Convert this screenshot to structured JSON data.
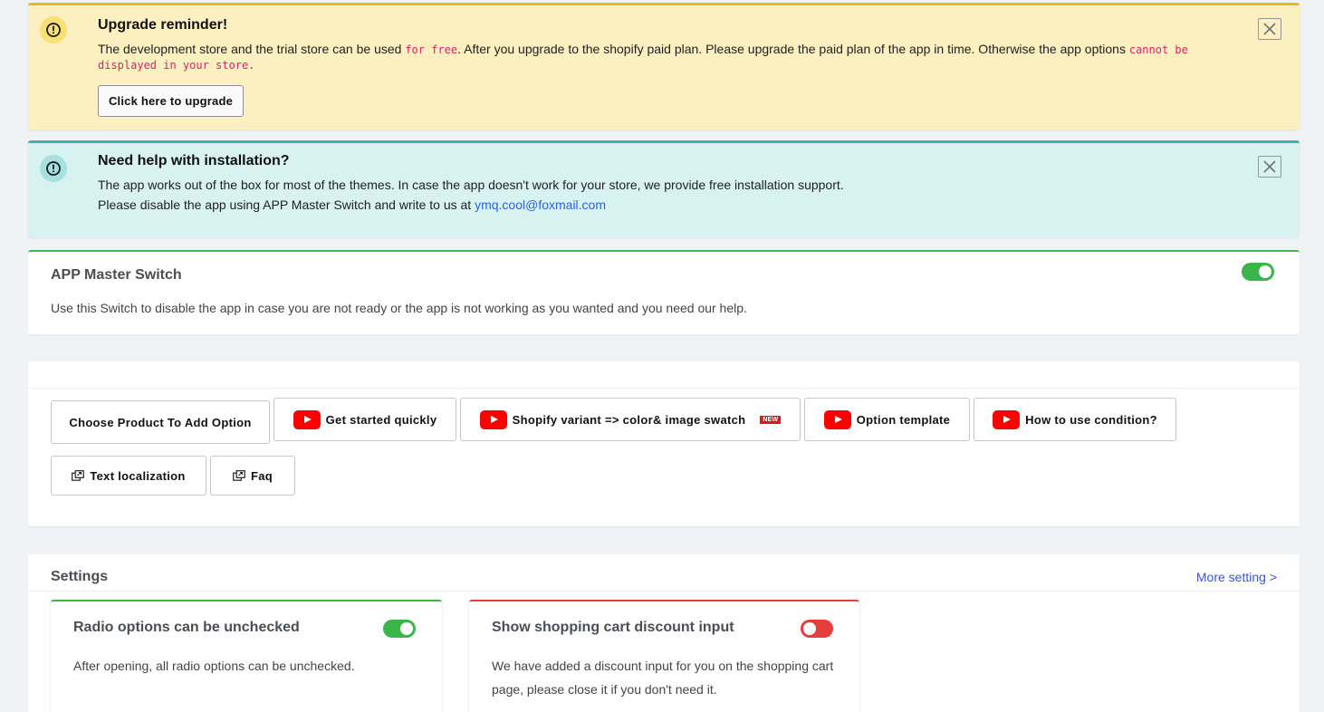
{
  "upgrade": {
    "title": "Upgrade reminder!",
    "text_1": "The development store and the trial store can be used ",
    "code_1": "for free",
    "text_2": ". After you upgrade to the shopify paid plan. Please upgrade the paid plan of the app in time. Otherwise the app options ",
    "code_2": "cannot be",
    "code_3": "displayed in your store.",
    "button_label": "Click here to upgrade",
    "icon": "exclamation-circle-icon"
  },
  "help": {
    "title": "Need help with installation?",
    "line_1": "The app works out of the box for most of the themes. In case the app doesn't work for your store, we provide free installation support.",
    "line_2_prefix": "Please disable the app using APP Master Switch and write to us at ",
    "email": "ymq.cool@foxmail.com",
    "icon": "info-circle-icon"
  },
  "master_switch": {
    "title": "APP Master Switch",
    "description": "Use this Switch to disable the app in case you are not ready or the app is not working as you wanted and you need our help.",
    "enabled": true
  },
  "actions": {
    "choose_product": "Choose Product To Add Option",
    "get_started": "Get started quickly",
    "variant_swatch": "Shopify variant => color& image swatch",
    "new_badge": "NEW",
    "option_template": "Option template",
    "use_condition": "How to use condition?",
    "text_localization": "Text localization",
    "faq": "Faq"
  },
  "settings": {
    "title": "Settings",
    "more_link": "More setting >",
    "radio": {
      "title": "Radio options can be unchecked",
      "description": "After opening, all radio options can be unchecked.",
      "enabled": true
    },
    "discount": {
      "title": "Show shopping cart discount input",
      "description_1": "We have added a discount input for you on the shopping cart",
      "description_2": "page, please close it if you don't need it.",
      "enabled": false
    }
  },
  "colors": {
    "accent_green": "#3ab549",
    "accent_red": "#e83d3d",
    "warning_yellow": "#f1b51c",
    "info_teal": "#46b3a9",
    "youtube_red": "#ff0000"
  }
}
